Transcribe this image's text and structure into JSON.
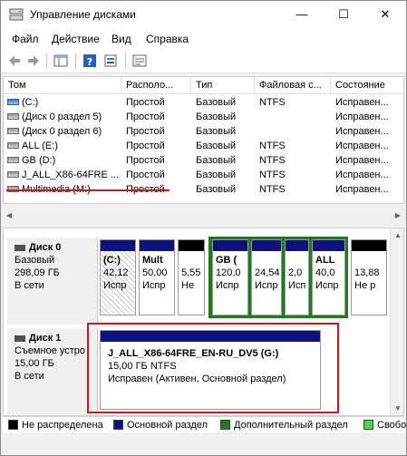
{
  "window": {
    "title": "Управление дисками",
    "colors": {
      "accent": "#0e1180",
      "red": "#d01818",
      "green": "#1f7a1f"
    }
  },
  "menu": [
    "Файл",
    "Действие",
    "Вид",
    "Справка"
  ],
  "volumes": {
    "columns": [
      "Том",
      "Располо...",
      "Тип",
      "Файловая с...",
      "Состояние"
    ],
    "rows": [
      {
        "name": "(C:)",
        "layout": "Простой",
        "type": "Базовый",
        "fs": "NTFS",
        "status": "Исправен..."
      },
      {
        "name": "(Диск 0 раздел 5)",
        "layout": "Простой",
        "type": "Базовый",
        "fs": "",
        "status": "Исправен..."
      },
      {
        "name": "(Диск 0 раздел 6)",
        "layout": "Простой",
        "type": "Базовый",
        "fs": "",
        "status": "Исправен..."
      },
      {
        "name": "ALL (E:)",
        "layout": "Простой",
        "type": "Базовый",
        "fs": "NTFS",
        "status": "Исправен..."
      },
      {
        "name": "GB (D:)",
        "layout": "Простой",
        "type": "Базовый",
        "fs": "NTFS",
        "status": "Исправен..."
      },
      {
        "name": "J_ALL_X86-64FRE ...",
        "layout": "Простой",
        "type": "Базовый",
        "fs": "NTFS",
        "status": "Исправен..."
      },
      {
        "name": "Multimedia (M:)",
        "layout": "Простой",
        "type": "Базовый",
        "fs": "NTFS",
        "status": "Исправен..."
      }
    ]
  },
  "disk0": {
    "name": "Диск 0",
    "type": "Базовый",
    "size": "298,09 ГБ",
    "state": "В сети",
    "partitions": [
      {
        "title": "(C:)",
        "size": "42,12",
        "status": "Испр"
      },
      {
        "title": "Mult",
        "size": "50,00",
        "status": "Испр"
      },
      {
        "title": "",
        "size": "5,55",
        "status": "Не"
      },
      {
        "title": "GB (",
        "size": "120,0",
        "status": "Испр"
      },
      {
        "title": "",
        "size": "24,54",
        "status": "Испр"
      },
      {
        "title": "",
        "size": "2,0",
        "status": "Исп"
      },
      {
        "title": "ALL",
        "size": "40,0",
        "status": "Испр"
      },
      {
        "title": "",
        "size": "13,88",
        "status": "Не р"
      }
    ]
  },
  "disk1": {
    "name": "Диск 1",
    "type": "Съемное устро",
    "size": "15,00 ГБ",
    "state": "В сети",
    "partition": {
      "title": "J_ALL_X86-64FRE_EN-RU_DV5  (G:)",
      "size": "15,00 ГБ NTFS",
      "status": "Исправен (Активен, Основной раздел)"
    }
  },
  "legend": [
    "Не распределена",
    "Основной раздел",
    "Дополнительный раздел",
    "Свобо"
  ]
}
